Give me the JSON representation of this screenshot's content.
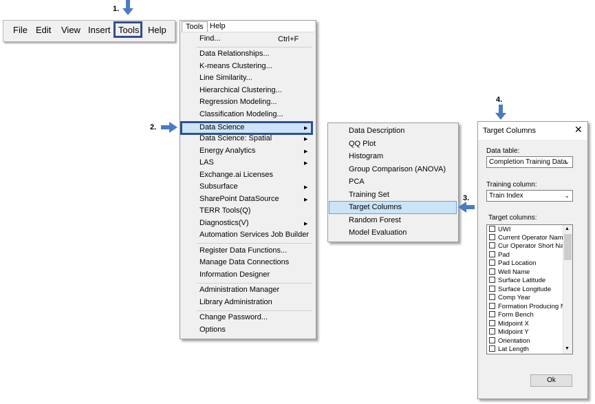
{
  "steps": {
    "s1": "1.",
    "s2": "2.",
    "s3": "3.",
    "s4": "4."
  },
  "colors": {
    "accent": "#2f4f8f",
    "arrow": "#4a7ac7",
    "highlight": "#cce4f7"
  },
  "menubar": {
    "items": [
      "File",
      "Edit",
      "View",
      "Insert",
      "Tools",
      "Help"
    ]
  },
  "tools_menu": {
    "tabs": [
      "Tools",
      "Help"
    ],
    "items": [
      {
        "label": "Find...",
        "shortcut": "Ctrl+F"
      },
      {
        "label": "Data Relationships..."
      },
      {
        "label": "K-means Clustering..."
      },
      {
        "label": "Line Similarity..."
      },
      {
        "label": "Hierarchical Clustering..."
      },
      {
        "label": "Regression Modeling..."
      },
      {
        "label": "Classification Modeling..."
      },
      {
        "label": "Data Science",
        "submenu": true
      },
      {
        "label": "Data Science: Spatial",
        "submenu": true
      },
      {
        "label": "Energy Analytics",
        "submenu": true
      },
      {
        "label": "LAS",
        "submenu": true
      },
      {
        "label": "Exchange.ai Licenses"
      },
      {
        "label": "Subsurface",
        "submenu": true
      },
      {
        "label": "SharePoint DataSource",
        "submenu": true
      },
      {
        "label": "TERR Tools(Q)"
      },
      {
        "label": "Diagnostics(V)",
        "submenu": true
      },
      {
        "label": "Automation Services Job Builder"
      },
      {
        "label": "Register Data Functions..."
      },
      {
        "label": "Manage Data Connections"
      },
      {
        "label": "Information Designer"
      },
      {
        "label": "Administration Manager"
      },
      {
        "label": "Library Administration"
      },
      {
        "label": "Change Password..."
      },
      {
        "label": "Options"
      }
    ]
  },
  "ds_menu": {
    "items": [
      "Data Description",
      "QQ Plot",
      "Histogram",
      "Group Comparison (ANOVA)",
      "PCA",
      "Training Set",
      "Target Columns",
      "Random Forest",
      "Model Evaluation"
    ]
  },
  "dialog": {
    "title": "Target Columns",
    "data_table_label": "Data table:",
    "data_table_value": "Completion Training Data",
    "training_column_label": "Training column:",
    "training_column_value": "Train Index",
    "target_columns_label": "Target columns:",
    "columns": [
      "UWI",
      "Current Operator Name",
      "Cur Operator Short Nam",
      "Pad",
      "Pad Location",
      "Well Name",
      "Surface Latitude",
      "Surface Longitude",
      "Comp Year",
      "Formation Producing Na",
      "Form Bench",
      "Midpoint X",
      "Midpoint Y",
      "Orientation",
      "Lat Length"
    ],
    "ok_label": "Ok"
  }
}
